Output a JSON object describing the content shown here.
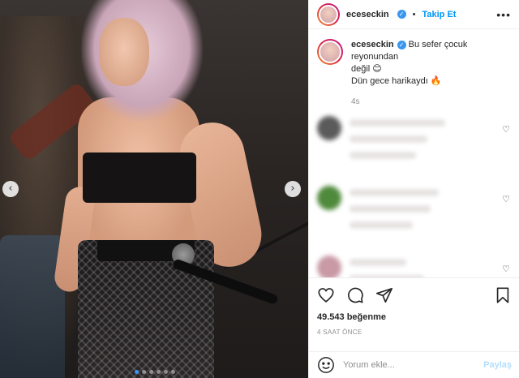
{
  "post": {
    "username": "eceseckin",
    "separator": "•",
    "follow_label": "Takip Et",
    "more_label": "•••",
    "caption_line1": "Bu sefer çocuk reyonundan",
    "caption_line2": "değil 😊",
    "caption_line3": "Dün gece harikaydı 🔥",
    "caption_time": "4s",
    "likes": "49.543 beğenme",
    "time_ago": "4 SAAT ÖNCE",
    "comment_placeholder": "Yorum ekle...",
    "post_label": "Paylaş",
    "verified_icon": "✓",
    "prev_arrow": "‹",
    "next_arrow": "›",
    "heart_icon": "♡"
  },
  "carousel": {
    "dot_count": 6,
    "active_index": 0
  },
  "colors": {
    "accent": "#0095f6",
    "verified": "#3897f0",
    "muted": "#8e8e8e"
  },
  "blurred_comments": [
    {
      "avatar_color": "#5a5a5a"
    },
    {
      "avatar_color": "#4f8a3c"
    },
    {
      "avatar_color": "#c99aa6"
    }
  ]
}
